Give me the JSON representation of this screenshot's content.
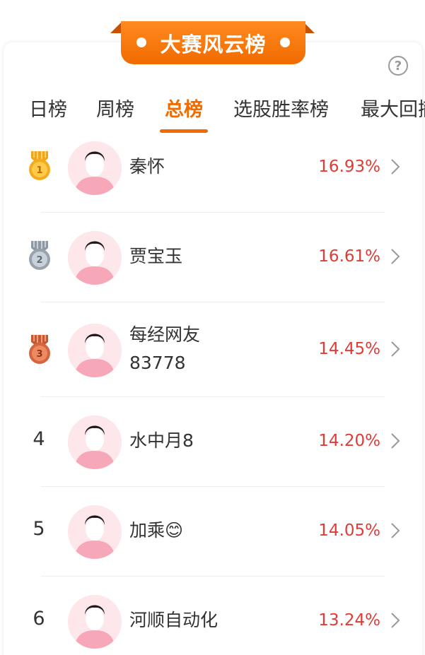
{
  "header": {
    "title": "大赛风云榜"
  },
  "help": {
    "icon": "help-circle-icon",
    "glyph": "?"
  },
  "tabs": [
    {
      "label": "日榜",
      "active": false
    },
    {
      "label": "周榜",
      "active": false
    },
    {
      "label": "总榜",
      "active": true
    },
    {
      "label": "选股胜率榜",
      "active": false
    },
    {
      "label": "最大回撤榜",
      "active": false
    }
  ],
  "rows": [
    {
      "rank": "1",
      "rank_icon": "gold-medal-icon",
      "name": "秦怀",
      "name_line2": "",
      "percent": "16.93%"
    },
    {
      "rank": "2",
      "rank_icon": "silver-medal-icon",
      "name": "贾宝玉",
      "name_line2": "",
      "percent": "16.61%"
    },
    {
      "rank": "3",
      "rank_icon": "bronze-medal-icon",
      "name": "每经网友",
      "name_line2": "83778",
      "percent": "14.45%"
    },
    {
      "rank": "4",
      "rank_icon": "",
      "name": "水中月8",
      "name_line2": "",
      "percent": "14.20%"
    },
    {
      "rank": "5",
      "rank_icon": "",
      "name": "加乘😊",
      "name_line2": "",
      "percent": "14.05%"
    },
    {
      "rank": "6",
      "rank_icon": "",
      "name": "河顺自动化",
      "name_line2": "",
      "percent": "13.24%"
    }
  ],
  "colors": {
    "accent": "#f06b00",
    "percent": "#e23b36",
    "gold": "#f2a51a",
    "silver": "#9aa3ad",
    "bronze": "#d5653f"
  }
}
